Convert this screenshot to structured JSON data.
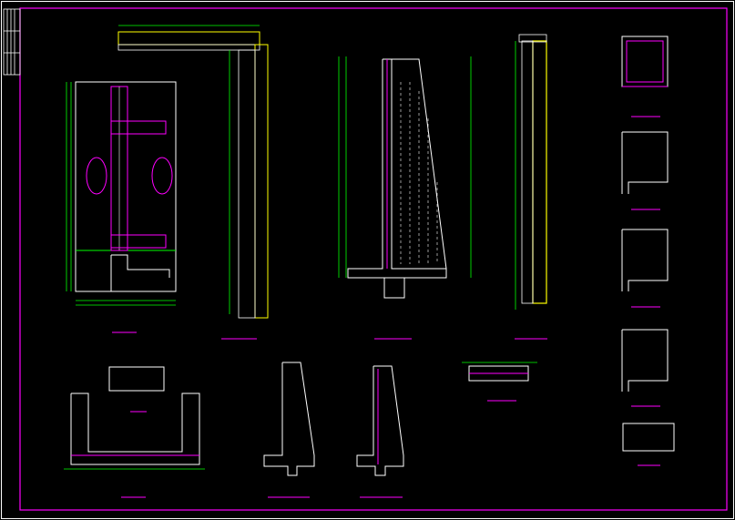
{
  "sheet": {
    "colors": {
      "background": "#000000",
      "frame": "#ffffff",
      "border": "#ff00ff",
      "dimension": "#00ff00",
      "detail": "#ffffff",
      "rebar": "#ff00ff",
      "hatch": "#ffff00",
      "annotation": "#00ffff"
    },
    "views": [
      "plan-section-left",
      "wall-elevation-tall",
      "counterfort-section",
      "narrow-wall-elevation",
      "detail-section-1",
      "detail-section-2",
      "detail-section-3",
      "detail-section-4",
      "detail-section-5",
      "detail-small-plan",
      "foundation-section",
      "counterfort-profile-1",
      "counterfort-profile-2",
      "beam-detail"
    ]
  }
}
